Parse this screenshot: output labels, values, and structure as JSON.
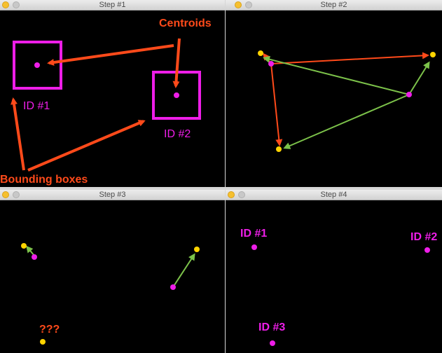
{
  "windows": [
    {
      "title": "Step #1"
    },
    {
      "title": "Step #2"
    },
    {
      "title": "Step #3"
    },
    {
      "title": "Step #4"
    }
  ],
  "step1": {
    "centroids_label": "Centroids",
    "bounding_boxes_label": "Bounding boxes",
    "id1_label": "ID #1",
    "id2_label": "ID #2"
  },
  "step3": {
    "unknown_label": "???"
  },
  "step4": {
    "id1_label": "ID #1",
    "id2_label": "ID #2",
    "id3_label": "ID #3"
  },
  "colors": {
    "magenta": "#ee1ee8",
    "red_orange": "#ff4a1a",
    "green": "#7cc24a",
    "yellow": "#ffd400",
    "background": "#000000"
  }
}
